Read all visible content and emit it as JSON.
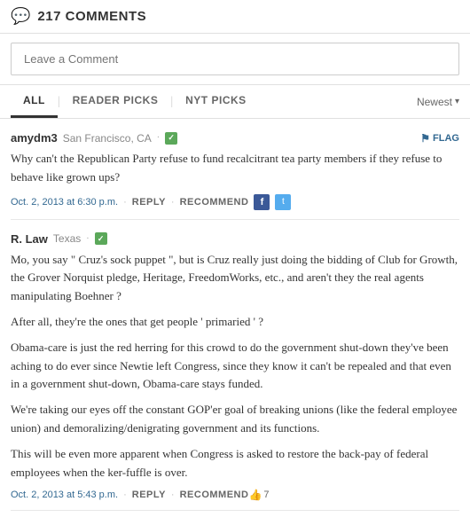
{
  "header": {
    "icon": "💬",
    "title": "217 COMMENTS"
  },
  "input": {
    "placeholder": "Leave a Comment"
  },
  "tabs": {
    "items": [
      {
        "id": "all",
        "label": "ALL",
        "active": true
      },
      {
        "id": "reader-picks",
        "label": "READER PICKS",
        "active": false
      },
      {
        "id": "nyt-picks",
        "label": "NYT PICKS",
        "active": false
      }
    ],
    "sort": {
      "label": "Newest",
      "arrow": "▾"
    }
  },
  "comments": [
    {
      "id": "comment-1",
      "author": "amydm3",
      "location": "San Francisco, CA",
      "verified": true,
      "flag_label": "FLAG",
      "body": "Why can't the Republican Party refuse to fund recalcitrant tea party members if they refuse to behave like grown ups?",
      "date": "Oct. 2, 2013 at 6:30 p.m.",
      "reply_label": "REPLY",
      "recommend_label": "RECOMMEND",
      "has_social": true,
      "recommend_count": null
    },
    {
      "id": "comment-2",
      "author": "R. Law",
      "location": "Texas",
      "verified": true,
      "flag_label": null,
      "body": "Mo, you say \" Cruz's sock puppet \", but is Cruz really just doing the bidding of Club for Growth, the Grover Norquist pledge, Heritage, FreedomWorks, etc., and aren't they the real agents manipulating Boehner ?\n\nAfter all, they're the ones that get people ' primaried ' ?\n\nObama-care is just the red herring for this crowd to do the government shut-down they've been aching to do ever since Newtie left Congress, since they know it can't be repealed and that even in a government shut-down, Obama-care stays funded.\n\nWe're taking our eyes off the constant GOP'er goal of breaking unions (like the federal employee union) and demoralizing/denigrating government and its functions.\n\nThis will be even more apparent when Congress is asked to restore the back-pay of federal employees when the ker-fuffle is over.",
      "date": "Oct. 2, 2013 at 5:43 p.m.",
      "reply_label": "REPLY",
      "recommend_label": "RECOMMEND",
      "has_social": false,
      "recommend_count": "7"
    }
  ]
}
